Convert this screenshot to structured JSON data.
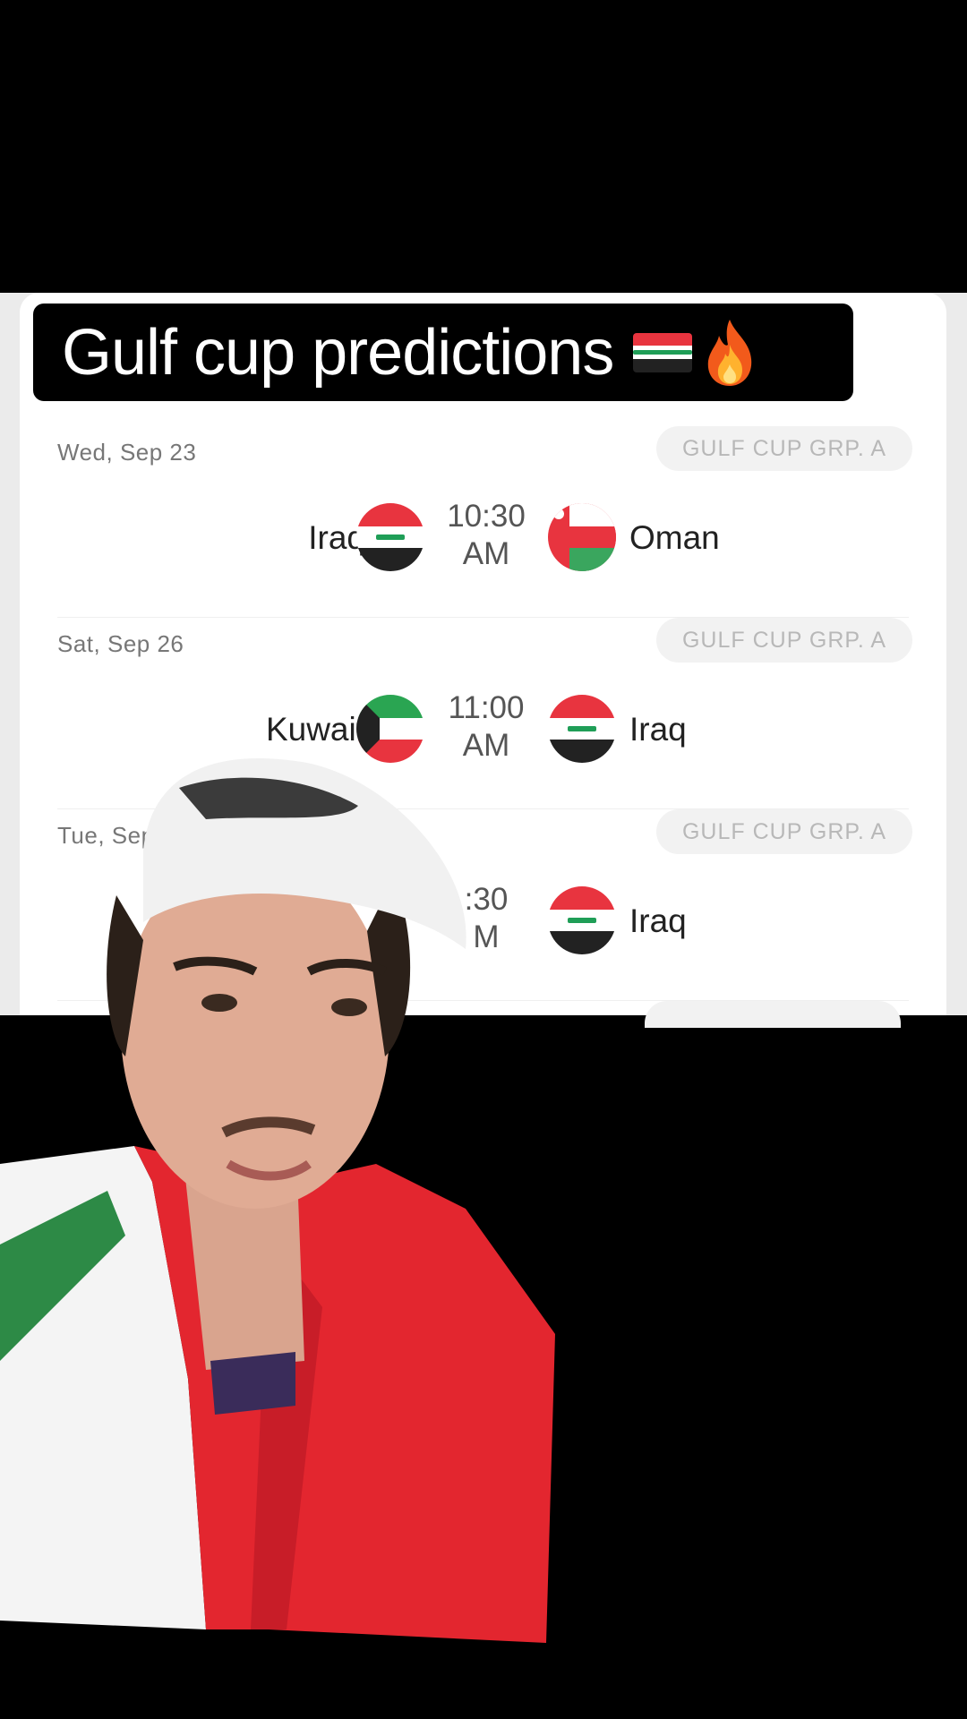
{
  "caption": {
    "text": "Gulf cup predictions",
    "emoji_icons": [
      "iraq-flag-icon",
      "fire-icon"
    ]
  },
  "matches": [
    {
      "date": "Wed, Sep 23",
      "competition": "GULF CUP GRP. A",
      "home": "Iraq",
      "away": "Oman",
      "time": "10:30",
      "ampm": "AM",
      "home_flag": "iraq-flag-icon",
      "away_flag": "oman-flag-icon"
    },
    {
      "date": "Sat, Sep 26",
      "competition": "GULF CUP GRP. A",
      "home": "Kuwait",
      "away": "Iraq",
      "time": "11:00",
      "ampm": "AM",
      "home_flag": "kuwait-flag-icon",
      "away_flag": "iraq-flag-icon"
    },
    {
      "date": "Tue, Sep ",
      "competition": "GULF CUP GRP. A",
      "home": "",
      "away": "Iraq",
      "time": ":30",
      "ampm": "M",
      "home_flag": "",
      "away_flag": "iraq-flag-icon"
    }
  ],
  "colors": {
    "iraq_red": "#e8343f",
    "iraq_black": "#222222",
    "iraq_green": "#1f9e57",
    "oman_red": "#e8343f",
    "oman_green": "#3aa65e",
    "kuwait_green": "#2aa552",
    "kuwait_red": "#e8343f"
  }
}
